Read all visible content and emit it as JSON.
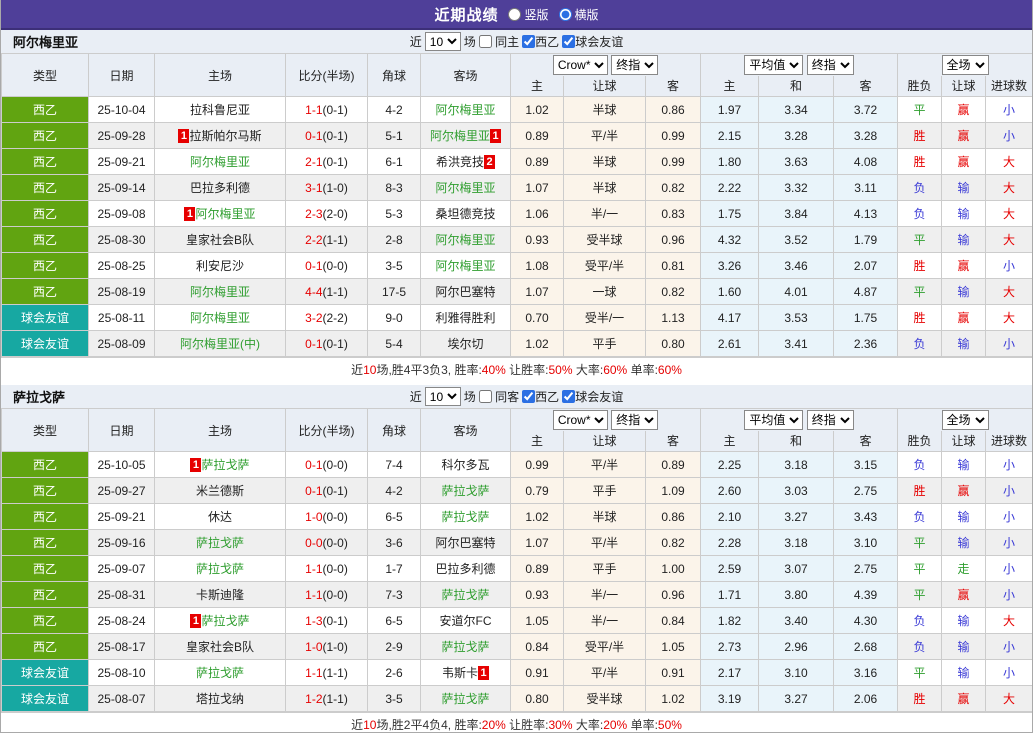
{
  "title_bar": {
    "title": "近期战绩",
    "vertical_label": "竖版",
    "horizontal_label": "横版"
  },
  "columns": {
    "left": [
      "类型",
      "日期",
      "主场",
      "比分(半场)",
      "角球",
      "客场"
    ],
    "sub": [
      "主",
      "让球",
      "客",
      "主",
      "和",
      "客",
      "胜负",
      "让球",
      "进球数"
    ]
  },
  "colors": {
    "titlebar": "#4f3f99",
    "league_badge": "#61a411",
    "friendly_badge": "#17a8a2",
    "team_focus_green": "#2f9e2f",
    "score_red": "#e60000",
    "win_red": "#e60000",
    "draw_green": "#2f9e2f",
    "lose_blue": "#3a3ad6"
  },
  "sections": [
    {
      "team": "阿尔梅里亚",
      "filter": {
        "prefix": "近",
        "count": "10",
        "suffix": "场",
        "same": "同主",
        "league": "西乙",
        "friendly": "球会友谊",
        "same_checked": false,
        "league_checked": true,
        "friendly_checked": true
      },
      "selects": {
        "odds_source": "Crow*",
        "odds_stage": "终指",
        "avg": "平均值",
        "avg_stage": "终指",
        "scope": "全场"
      },
      "rows": [
        {
          "type": "西乙",
          "tc": "l",
          "date": "25-10-04",
          "home": "拉科鲁尼亚",
          "hg": false,
          "hcard": "",
          "score": "1-1",
          "half": "(0-1)",
          "corner": "4-2",
          "away": "阿尔梅里亚",
          "ag": true,
          "acard": "",
          "o1": "1.02",
          "o2": "半球",
          "o3": "0.86",
          "m1": "1.97",
          "m2": "3.34",
          "m3": "3.72",
          "r1": {
            "t": "平",
            "c": "g"
          },
          "r2": {
            "t": "赢",
            "c": "r"
          },
          "r3": {
            "t": "小",
            "c": "b"
          }
        },
        {
          "type": "西乙",
          "tc": "l",
          "date": "25-09-28",
          "home": "拉斯帕尔马斯",
          "hg": false,
          "hcard": "1",
          "score": "0-1",
          "half": "(0-1)",
          "corner": "5-1",
          "away": "阿尔梅里亚",
          "ag": true,
          "acard": "1",
          "o1": "0.89",
          "o2": "平/半",
          "o3": "0.99",
          "m1": "2.15",
          "m2": "3.28",
          "m3": "3.28",
          "r1": {
            "t": "胜",
            "c": "r"
          },
          "r2": {
            "t": "赢",
            "c": "r"
          },
          "r3": {
            "t": "小",
            "c": "b"
          }
        },
        {
          "type": "西乙",
          "tc": "l",
          "date": "25-09-21",
          "home": "阿尔梅里亚",
          "hg": true,
          "hcard": "",
          "score": "2-1",
          "half": "(0-1)",
          "corner": "6-1",
          "away": "希洪竞技",
          "ag": false,
          "acard": "2",
          "o1": "0.89",
          "o2": "半球",
          "o3": "0.99",
          "m1": "1.80",
          "m2": "3.63",
          "m3": "4.08",
          "r1": {
            "t": "胜",
            "c": "r"
          },
          "r2": {
            "t": "赢",
            "c": "r"
          },
          "r3": {
            "t": "大",
            "c": "r"
          }
        },
        {
          "type": "西乙",
          "tc": "l",
          "date": "25-09-14",
          "home": "巴拉多利德",
          "hg": false,
          "hcard": "",
          "score": "3-1",
          "half": "(1-0)",
          "corner": "8-3",
          "away": "阿尔梅里亚",
          "ag": true,
          "acard": "",
          "o1": "1.07",
          "o2": "半球",
          "o3": "0.82",
          "m1": "2.22",
          "m2": "3.32",
          "m3": "3.11",
          "r1": {
            "t": "负",
            "c": "b"
          },
          "r2": {
            "t": "输",
            "c": "b"
          },
          "r3": {
            "t": "大",
            "c": "r"
          }
        },
        {
          "type": "西乙",
          "tc": "l",
          "date": "25-09-08",
          "home": "阿尔梅里亚",
          "hg": true,
          "hcard": "1",
          "score": "2-3",
          "half": "(2-0)",
          "corner": "5-3",
          "away": "桑坦德竞技",
          "ag": false,
          "acard": "",
          "o1": "1.06",
          "o2": "半/一",
          "o3": "0.83",
          "m1": "1.75",
          "m2": "3.84",
          "m3": "4.13",
          "r1": {
            "t": "负",
            "c": "b"
          },
          "r2": {
            "t": "输",
            "c": "b"
          },
          "r3": {
            "t": "大",
            "c": "r"
          }
        },
        {
          "type": "西乙",
          "tc": "l",
          "date": "25-08-30",
          "home": "皇家社会B队",
          "hg": false,
          "hcard": "",
          "score": "2-2",
          "half": "(1-1)",
          "corner": "2-8",
          "away": "阿尔梅里亚",
          "ag": true,
          "acard": "",
          "o1": "0.93",
          "o2": "受半球",
          "o3": "0.96",
          "m1": "4.32",
          "m2": "3.52",
          "m3": "1.79",
          "r1": {
            "t": "平",
            "c": "g"
          },
          "r2": {
            "t": "输",
            "c": "b"
          },
          "r3": {
            "t": "大",
            "c": "r"
          }
        },
        {
          "type": "西乙",
          "tc": "l",
          "date": "25-08-25",
          "home": "利安尼沙",
          "hg": false,
          "hcard": "",
          "score": "0-1",
          "half": "(0-0)",
          "corner": "3-5",
          "away": "阿尔梅里亚",
          "ag": true,
          "acard": "",
          "o1": "1.08",
          "o2": "受平/半",
          "o3": "0.81",
          "m1": "3.26",
          "m2": "3.46",
          "m3": "2.07",
          "r1": {
            "t": "胜",
            "c": "r"
          },
          "r2": {
            "t": "赢",
            "c": "r"
          },
          "r3": {
            "t": "小",
            "c": "b"
          }
        },
        {
          "type": "西乙",
          "tc": "l",
          "date": "25-08-19",
          "home": "阿尔梅里亚",
          "hg": true,
          "hcard": "",
          "score": "4-4",
          "half": "(1-1)",
          "corner": "17-5",
          "away": "阿尔巴塞特",
          "ag": false,
          "acard": "",
          "o1": "1.07",
          "o2": "一球",
          "o3": "0.82",
          "m1": "1.60",
          "m2": "4.01",
          "m3": "4.87",
          "r1": {
            "t": "平",
            "c": "g"
          },
          "r2": {
            "t": "输",
            "c": "b"
          },
          "r3": {
            "t": "大",
            "c": "r"
          }
        },
        {
          "type": "球会友谊",
          "tc": "f",
          "date": "25-08-11",
          "home": "阿尔梅里亚",
          "hg": true,
          "hcard": "",
          "score": "3-2",
          "half": "(2-2)",
          "corner": "9-0",
          "away": "利雅得胜利",
          "ag": false,
          "acard": "",
          "o1": "0.70",
          "o2": "受半/一",
          "o3": "1.13",
          "m1": "4.17",
          "m2": "3.53",
          "m3": "1.75",
          "r1": {
            "t": "胜",
            "c": "r"
          },
          "r2": {
            "t": "赢",
            "c": "r"
          },
          "r3": {
            "t": "大",
            "c": "r"
          }
        },
        {
          "type": "球会友谊",
          "tc": "f",
          "date": "25-08-09",
          "home": "阿尔梅里亚(中)",
          "hg": true,
          "hcard": "",
          "score": "0-1",
          "half": "(0-1)",
          "corner": "5-4",
          "away": "埃尔切",
          "ag": false,
          "acard": "",
          "o1": "1.02",
          "o2": "平手",
          "o3": "0.80",
          "m1": "2.61",
          "m2": "3.41",
          "m3": "2.36",
          "r1": {
            "t": "负",
            "c": "b"
          },
          "r2": {
            "t": "输",
            "c": "b"
          },
          "r3": {
            "t": "小",
            "c": "b"
          }
        }
      ],
      "summary": [
        {
          "t": "近"
        },
        {
          "t": "10",
          "red": true
        },
        {
          "t": "场,胜4平3负3, 胜率:"
        },
        {
          "t": "40%",
          "red": true
        },
        {
          "t": " 让胜率:"
        },
        {
          "t": "50%",
          "red": true
        },
        {
          "t": " 大率:"
        },
        {
          "t": "60%",
          "red": true
        },
        {
          "t": " 单率:"
        },
        {
          "t": "60%",
          "red": true
        }
      ]
    },
    {
      "team": "萨拉戈萨",
      "filter": {
        "prefix": "近",
        "count": "10",
        "suffix": "场",
        "same": "同客",
        "league": "西乙",
        "friendly": "球会友谊",
        "same_checked": false,
        "league_checked": true,
        "friendly_checked": true
      },
      "selects": {
        "odds_source": "Crow*",
        "odds_stage": "终指",
        "avg": "平均值",
        "avg_stage": "终指",
        "scope": "全场"
      },
      "rows": [
        {
          "type": "西乙",
          "tc": "l",
          "date": "25-10-05",
          "home": "萨拉戈萨",
          "hg": true,
          "hcard": "1",
          "score": "0-1",
          "half": "(0-0)",
          "corner": "7-4",
          "away": "科尔多瓦",
          "ag": false,
          "acard": "",
          "o1": "0.99",
          "o2": "平/半",
          "o3": "0.89",
          "m1": "2.25",
          "m2": "3.18",
          "m3": "3.15",
          "r1": {
            "t": "负",
            "c": "b"
          },
          "r2": {
            "t": "输",
            "c": "b"
          },
          "r3": {
            "t": "小",
            "c": "b"
          }
        },
        {
          "type": "西乙",
          "tc": "l",
          "date": "25-09-27",
          "home": "米兰德斯",
          "hg": false,
          "hcard": "",
          "score": "0-1",
          "half": "(0-1)",
          "corner": "4-2",
          "away": "萨拉戈萨",
          "ag": true,
          "acard": "",
          "o1": "0.79",
          "o2": "平手",
          "o3": "1.09",
          "m1": "2.60",
          "m2": "3.03",
          "m3": "2.75",
          "r1": {
            "t": "胜",
            "c": "r"
          },
          "r2": {
            "t": "赢",
            "c": "r"
          },
          "r3": {
            "t": "小",
            "c": "b"
          }
        },
        {
          "type": "西乙",
          "tc": "l",
          "date": "25-09-21",
          "home": "休达",
          "hg": false,
          "hcard": "",
          "score": "1-0",
          "half": "(0-0)",
          "corner": "6-5",
          "away": "萨拉戈萨",
          "ag": true,
          "acard": "",
          "o1": "1.02",
          "o2": "半球",
          "o3": "0.86",
          "m1": "2.10",
          "m2": "3.27",
          "m3": "3.43",
          "r1": {
            "t": "负",
            "c": "b"
          },
          "r2": {
            "t": "输",
            "c": "b"
          },
          "r3": {
            "t": "小",
            "c": "b"
          }
        },
        {
          "type": "西乙",
          "tc": "l",
          "date": "25-09-16",
          "home": "萨拉戈萨",
          "hg": true,
          "hcard": "",
          "score": "0-0",
          "half": "(0-0)",
          "corner": "3-6",
          "away": "阿尔巴塞特",
          "ag": false,
          "acard": "",
          "o1": "1.07",
          "o2": "平/半",
          "o3": "0.82",
          "m1": "2.28",
          "m2": "3.18",
          "m3": "3.10",
          "r1": {
            "t": "平",
            "c": "g"
          },
          "r2": {
            "t": "输",
            "c": "b"
          },
          "r3": {
            "t": "小",
            "c": "b"
          }
        },
        {
          "type": "西乙",
          "tc": "l",
          "date": "25-09-07",
          "home": "萨拉戈萨",
          "hg": true,
          "hcard": "",
          "score": "1-1",
          "half": "(0-0)",
          "corner": "1-7",
          "away": "巴拉多利德",
          "ag": false,
          "acard": "",
          "o1": "0.89",
          "o2": "平手",
          "o3": "1.00",
          "m1": "2.59",
          "m2": "3.07",
          "m3": "2.75",
          "r1": {
            "t": "平",
            "c": "g"
          },
          "r2": {
            "t": "走",
            "c": "g"
          },
          "r3": {
            "t": "小",
            "c": "b"
          }
        },
        {
          "type": "西乙",
          "tc": "l",
          "date": "25-08-31",
          "home": "卡斯迪隆",
          "hg": false,
          "hcard": "",
          "score": "1-1",
          "half": "(0-0)",
          "corner": "7-3",
          "away": "萨拉戈萨",
          "ag": true,
          "acard": "",
          "o1": "0.93",
          "o2": "半/一",
          "o3": "0.96",
          "m1": "1.71",
          "m2": "3.80",
          "m3": "4.39",
          "r1": {
            "t": "平",
            "c": "g"
          },
          "r2": {
            "t": "赢",
            "c": "r"
          },
          "r3": {
            "t": "小",
            "c": "b"
          }
        },
        {
          "type": "西乙",
          "tc": "l",
          "date": "25-08-24",
          "home": "萨拉戈萨",
          "hg": true,
          "hcard": "1",
          "score": "1-3",
          "half": "(0-1)",
          "corner": "6-5",
          "away": "安道尔FC",
          "ag": false,
          "acard": "",
          "o1": "1.05",
          "o2": "半/一",
          "o3": "0.84",
          "m1": "1.82",
          "m2": "3.40",
          "m3": "4.30",
          "r1": {
            "t": "负",
            "c": "b"
          },
          "r2": {
            "t": "输",
            "c": "b"
          },
          "r3": {
            "t": "大",
            "c": "r"
          }
        },
        {
          "type": "西乙",
          "tc": "l",
          "date": "25-08-17",
          "home": "皇家社会B队",
          "hg": false,
          "hcard": "",
          "score": "1-0",
          "half": "(1-0)",
          "corner": "2-9",
          "away": "萨拉戈萨",
          "ag": true,
          "acard": "",
          "o1": "0.84",
          "o2": "受平/半",
          "o3": "1.05",
          "m1": "2.73",
          "m2": "2.96",
          "m3": "2.68",
          "r1": {
            "t": "负",
            "c": "b"
          },
          "r2": {
            "t": "输",
            "c": "b"
          },
          "r3": {
            "t": "小",
            "c": "b"
          }
        },
        {
          "type": "球会友谊",
          "tc": "f",
          "date": "25-08-10",
          "home": "萨拉戈萨",
          "hg": true,
          "hcard": "",
          "score": "1-1",
          "half": "(1-1)",
          "corner": "2-6",
          "away": "韦斯卡",
          "ag": false,
          "acard": "1",
          "o1": "0.91",
          "o2": "平/半",
          "o3": "0.91",
          "m1": "2.17",
          "m2": "3.10",
          "m3": "3.16",
          "r1": {
            "t": "平",
            "c": "g"
          },
          "r2": {
            "t": "输",
            "c": "b"
          },
          "r3": {
            "t": "小",
            "c": "b"
          }
        },
        {
          "type": "球会友谊",
          "tc": "f",
          "date": "25-08-07",
          "home": "塔拉戈纳",
          "hg": false,
          "hcard": "",
          "score": "1-2",
          "half": "(1-1)",
          "corner": "3-5",
          "away": "萨拉戈萨",
          "ag": true,
          "acard": "",
          "o1": "0.80",
          "o2": "受半球",
          "o3": "1.02",
          "m1": "3.19",
          "m2": "3.27",
          "m3": "2.06",
          "r1": {
            "t": "胜",
            "c": "r"
          },
          "r2": {
            "t": "赢",
            "c": "r"
          },
          "r3": {
            "t": "大",
            "c": "r"
          }
        }
      ],
      "summary": [
        {
          "t": "近"
        },
        {
          "t": "10",
          "red": true
        },
        {
          "t": "场,胜2平4负4, 胜率:"
        },
        {
          "t": "20%",
          "red": true
        },
        {
          "t": " 让胜率:"
        },
        {
          "t": "30%",
          "red": true
        },
        {
          "t": " 大率:"
        },
        {
          "t": "20%",
          "red": true
        },
        {
          "t": " 单率:"
        },
        {
          "t": "50%",
          "red": true
        }
      ]
    }
  ]
}
